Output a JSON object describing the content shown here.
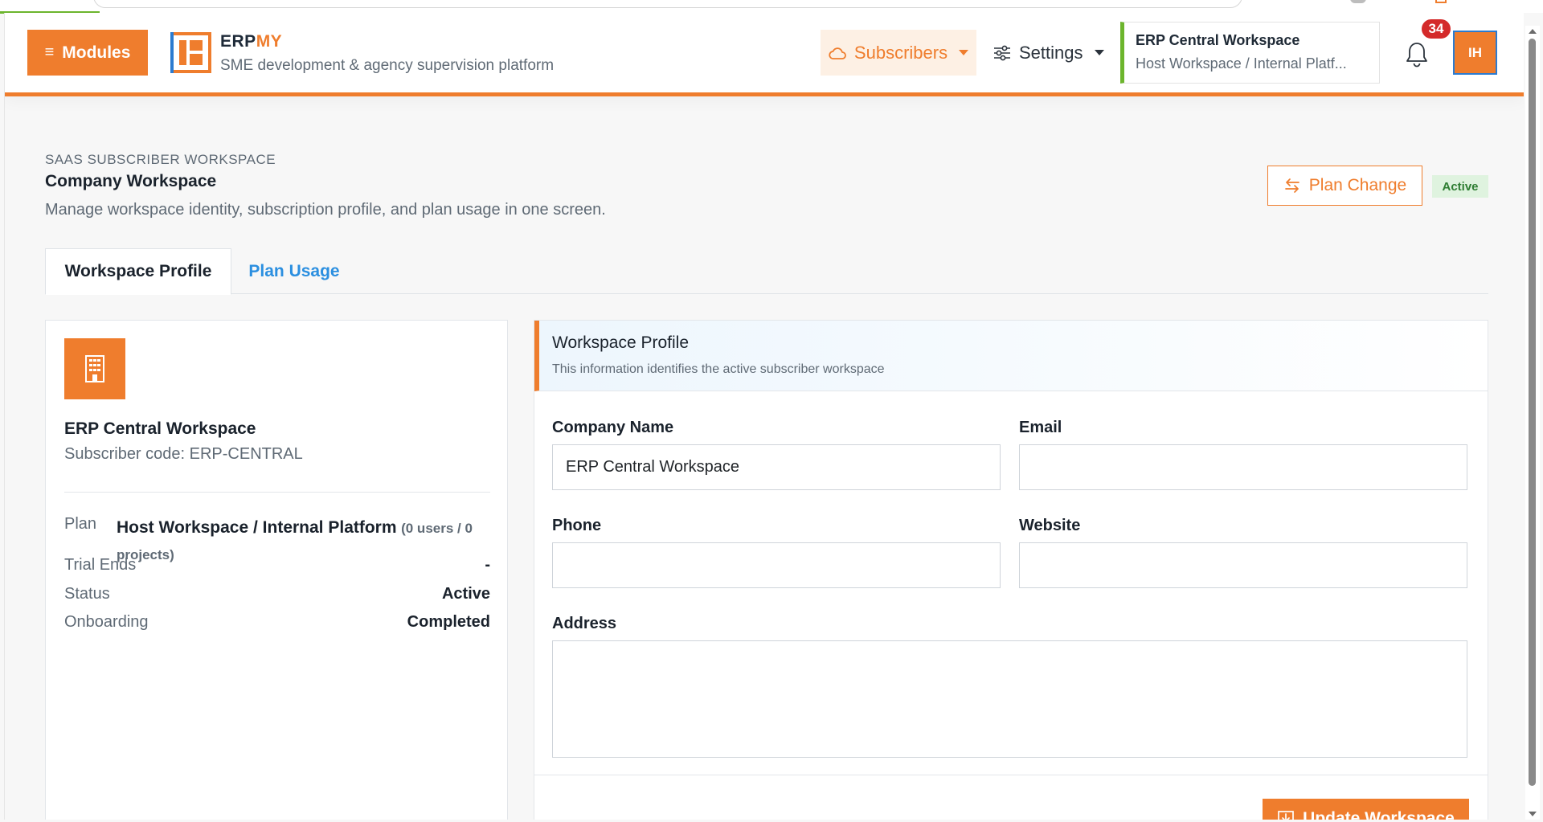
{
  "header": {
    "modules_label": "Modules",
    "brand_prefix": "ERP",
    "brand_accent": "MY",
    "brand_tagline": "SME development & agency supervision platform",
    "subscribers_label": "Subscribers",
    "settings_label": "Settings",
    "workspace_switcher": {
      "title": "ERP Central Workspace",
      "subtitle": "Host Workspace / Internal Platf..."
    },
    "notification_count": "34",
    "avatar_initials": "IH"
  },
  "page": {
    "eyebrow": "SAAS SUBSCRIBER WORKSPACE",
    "title": "Company Workspace",
    "description": "Manage workspace identity, subscription profile, and plan usage in one screen.",
    "plan_change_label": "Plan Change",
    "status_badge": "Active"
  },
  "tabs": [
    {
      "label": "Workspace Profile",
      "active": true
    },
    {
      "label": "Plan Usage",
      "active": false
    }
  ],
  "summary_card": {
    "company_name": "ERP Central Workspace",
    "subscriber_code": "Subscriber code: ERP-CENTRAL",
    "plan_label": "Plan",
    "plan_name": "Host Workspace / Internal Platform",
    "plan_usage": "(0 users / 0 projects)",
    "rows": [
      {
        "label": "Trial Ends",
        "value": "-"
      },
      {
        "label": "Status",
        "value": "Active"
      },
      {
        "label": "Onboarding",
        "value": "Completed"
      }
    ]
  },
  "profile_form": {
    "section_title": "Workspace Profile",
    "section_desc": "This information identifies the active subscriber workspace",
    "company_name_label": "Company Name",
    "company_name_value": "ERP Central Workspace",
    "email_label": "Email",
    "email_value": "",
    "phone_label": "Phone",
    "phone_value": "",
    "website_label": "Website",
    "website_value": "",
    "address_label": "Address",
    "address_value": "",
    "submit_label": "Update Workspace"
  },
  "colors": {
    "accent": "#ef7d2d",
    "success": "#2e7d32",
    "link": "#2b8fe0",
    "notification": "#d42a2a"
  },
  "icons": {
    "modules": "hamburger-icon",
    "subscribers": "cloud-icon",
    "settings": "sliders-icon",
    "notifications": "bell-icon",
    "plan_change": "swap-icon",
    "company": "building-icon",
    "update": "download-box-icon"
  }
}
